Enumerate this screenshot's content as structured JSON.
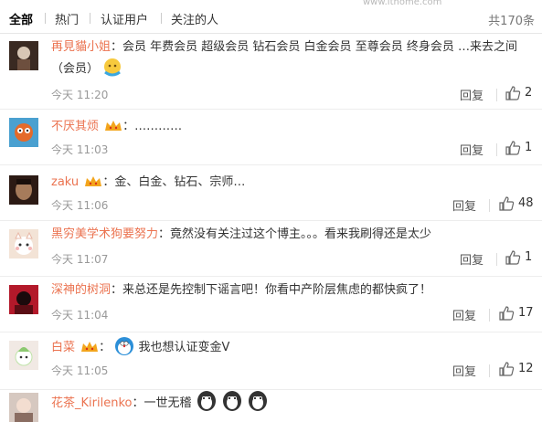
{
  "watermark": "www.ithome.com",
  "tabs": [
    {
      "label": "全部"
    },
    {
      "label": "热门"
    },
    {
      "label": "认证用户"
    },
    {
      "label": "关注的人"
    }
  ],
  "total": "共170条",
  "reply_label": "回复",
  "comments": [
    {
      "user": "再見貓小姐",
      "sep": "：",
      "text": "会员 年费会员 超级会员 钻石会员 白金会员 至尊会员 终身会员 …来去之间（会员）",
      "time": "今天 11:20",
      "likes": "2",
      "avatar_color": "#3a2a22"
    },
    {
      "user": "不厌其烦",
      "sep": "：",
      "text": "…………",
      "time": "今天 11:03",
      "likes": "1",
      "avatar_color": "#d9562d"
    },
    {
      "user": "zaku",
      "sep": "：",
      "text": "金、白金、钻石、宗师…",
      "time": "今天 11:06",
      "likes": "48",
      "avatar_color": "#2c1a14"
    },
    {
      "user": "黑穷美学术狗要努力",
      "sep": "：",
      "text": "竟然没有关注过这个博主。。。看来我刷得还是太少",
      "time": "今天 11:07",
      "likes": "1",
      "avatar_color": "#f3e3d6"
    },
    {
      "user": "深神的树洞",
      "sep": "：",
      "text": "来总还是先控制下谣言吧！你看中产阶层焦虑的都快疯了！",
      "time": "今天 11:04",
      "likes": "17",
      "avatar_color": "#b3192a"
    },
    {
      "user": "白菜",
      "sep": "：",
      "text": "我也想认证变金V",
      "time": "今天 11:05",
      "likes": "12",
      "avatar_color": "#f1e9e4"
    },
    {
      "user": "花茶_Kirilenko",
      "sep": "：",
      "text": "一世无稽",
      "time": "",
      "likes": "",
      "avatar_color": "#d6c8c0"
    }
  ]
}
